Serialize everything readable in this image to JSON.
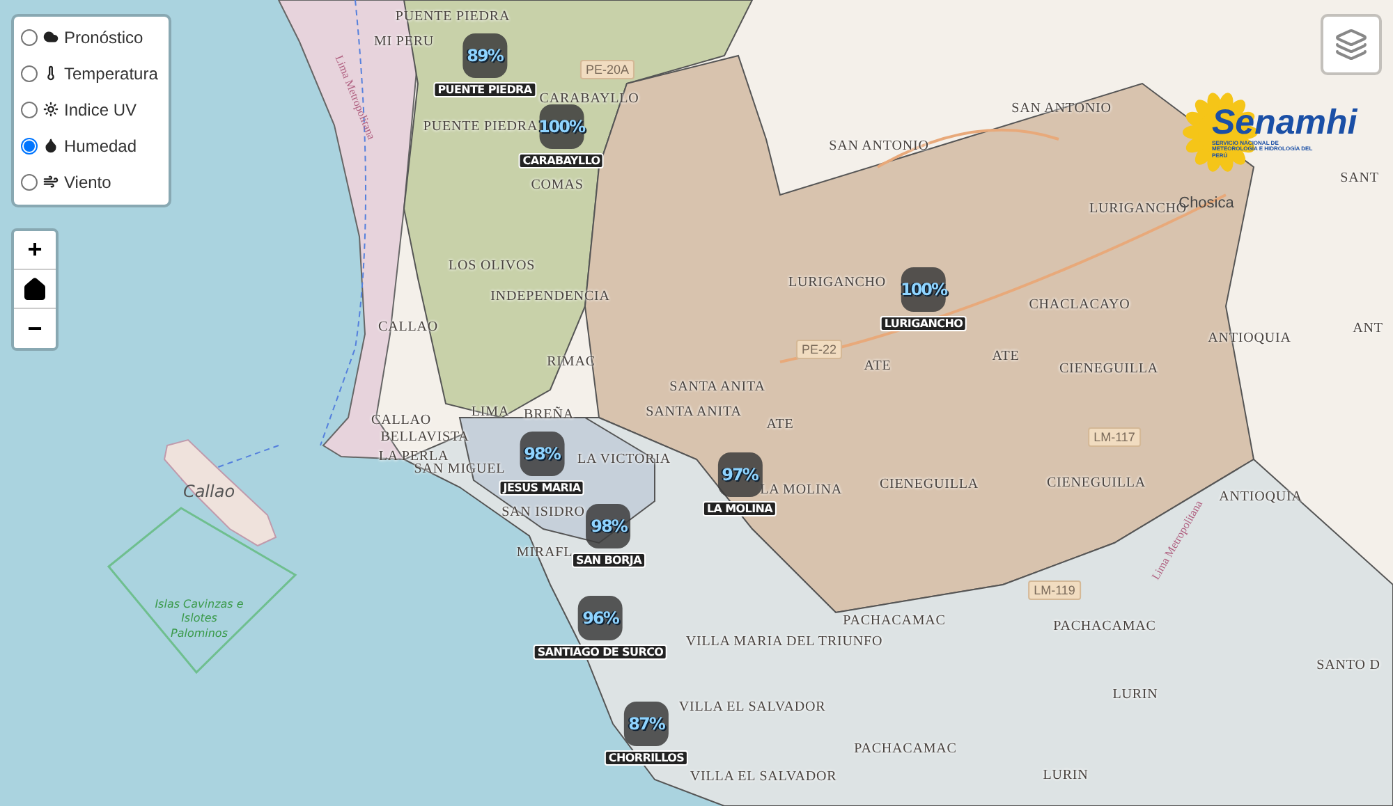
{
  "layer_panel": {
    "options": [
      {
        "label": "Pronóstico",
        "selected": false
      },
      {
        "label": "Temperatura",
        "selected": false
      },
      {
        "label": "Indice UV",
        "selected": false
      },
      {
        "label": "Humedad",
        "selected": true
      },
      {
        "label": "Viento",
        "selected": false
      }
    ]
  },
  "zoom_controls": {
    "zoom_in": "+",
    "zoom_out": "−"
  },
  "logo": {
    "name": "Senamhi",
    "subtitle": "SERVICIO NACIONAL DE METEOROLOGÍA E HIDROLOGÍA DEL PERÚ"
  },
  "map_labels": [
    {
      "text": "PUENTE PIEDRA",
      "kind": "district"
    },
    {
      "text": "MI PERU",
      "kind": "district"
    },
    {
      "text": "PUENTE PIEDRA",
      "kind": "district"
    },
    {
      "text": "CARABAYLLO",
      "kind": "district"
    },
    {
      "text": "COMAS",
      "kind": "district"
    },
    {
      "text": "LOS OLIVOS",
      "kind": "district"
    },
    {
      "text": "INDEPENDENCIA",
      "kind": "district"
    },
    {
      "text": "CALLAO",
      "kind": "district"
    },
    {
      "text": "RIMAC",
      "kind": "district"
    },
    {
      "text": "CALLAO",
      "kind": "district"
    },
    {
      "text": "LIMA",
      "kind": "district"
    },
    {
      "text": "BELLAVISTA",
      "kind": "district"
    },
    {
      "text": "LA PERLA",
      "kind": "district"
    },
    {
      "text": "SAN MIGUEL",
      "kind": "district"
    },
    {
      "text": "BREÑA",
      "kind": "district"
    },
    {
      "text": "LA VICTORIA",
      "kind": "district"
    },
    {
      "text": "SAN ISIDRO",
      "kind": "district"
    },
    {
      "text": "MIRAFL",
      "kind": "district"
    },
    {
      "text": "Callao",
      "kind": "island"
    },
    {
      "text": "Islas Cavinzas e Islotes Palominos",
      "kind": "reserve"
    },
    {
      "text": "SAN ANTONIO",
      "kind": "district"
    },
    {
      "text": "SAN ANTONIO",
      "kind": "district"
    },
    {
      "text": "LURIGANCHO",
      "kind": "district"
    },
    {
      "text": "Chosica",
      "kind": "city"
    },
    {
      "text": "SANT",
      "kind": "district"
    },
    {
      "text": "LURIGANCHO",
      "kind": "district"
    },
    {
      "text": "CHACLACAYO",
      "kind": "district"
    },
    {
      "text": "ANTIOQUIA",
      "kind": "district"
    },
    {
      "text": "ANT",
      "kind": "district"
    },
    {
      "text": "ATE",
      "kind": "district"
    },
    {
      "text": "ATE",
      "kind": "district"
    },
    {
      "text": "CIENEGUILLA",
      "kind": "district"
    },
    {
      "text": "SANTA ANITA",
      "kind": "district"
    },
    {
      "text": "SANTA ANITA",
      "kind": "district"
    },
    {
      "text": "ATE",
      "kind": "district"
    },
    {
      "text": "CIENEGUILLA",
      "kind": "district"
    },
    {
      "text": "CIENEGUILLA",
      "kind": "district"
    },
    {
      "text": "ANTIOQUIA",
      "kind": "district"
    },
    {
      "text": "LA MOLINA",
      "kind": "district"
    },
    {
      "text": "PACHACAMAC",
      "kind": "district"
    },
    {
      "text": "PACHACAMAC",
      "kind": "district"
    },
    {
      "text": "VILLA MARIA DEL TRIUNFO",
      "kind": "district"
    },
    {
      "text": "LURIN",
      "kind": "district"
    },
    {
      "text": "SANTO D",
      "kind": "district"
    },
    {
      "text": "VILLA EL SALVADOR",
      "kind": "district"
    },
    {
      "text": "PACHACAMAC",
      "kind": "district"
    },
    {
      "text": "VILLA EL SALVADOR",
      "kind": "district"
    },
    {
      "text": "LURIN",
      "kind": "district"
    },
    {
      "text": "PE-20A",
      "kind": "shield"
    },
    {
      "text": "PE-22",
      "kind": "shield"
    },
    {
      "text": "LM-117",
      "kind": "shield"
    },
    {
      "text": "LM-119",
      "kind": "shield"
    },
    {
      "text": "Lima Metropolitana",
      "kind": "road"
    },
    {
      "text": "Lima Metropolitana",
      "kind": "road"
    }
  ],
  "markers": [
    {
      "value": "89%",
      "name": "PUENTE PIEDRA"
    },
    {
      "value": "100%",
      "name": "CARABAYLLO"
    },
    {
      "value": "100%",
      "name": "LURIGANCHO"
    },
    {
      "value": "98%",
      "name": "JESUS MARIA"
    },
    {
      "value": "97%",
      "name": "LA MOLINA"
    },
    {
      "value": "98%",
      "name": "SAN BORJA"
    },
    {
      "value": "96%",
      "name": "SANTIAGO DE SURCO"
    },
    {
      "value": "87%",
      "name": "CHORRILLOS"
    }
  ]
}
